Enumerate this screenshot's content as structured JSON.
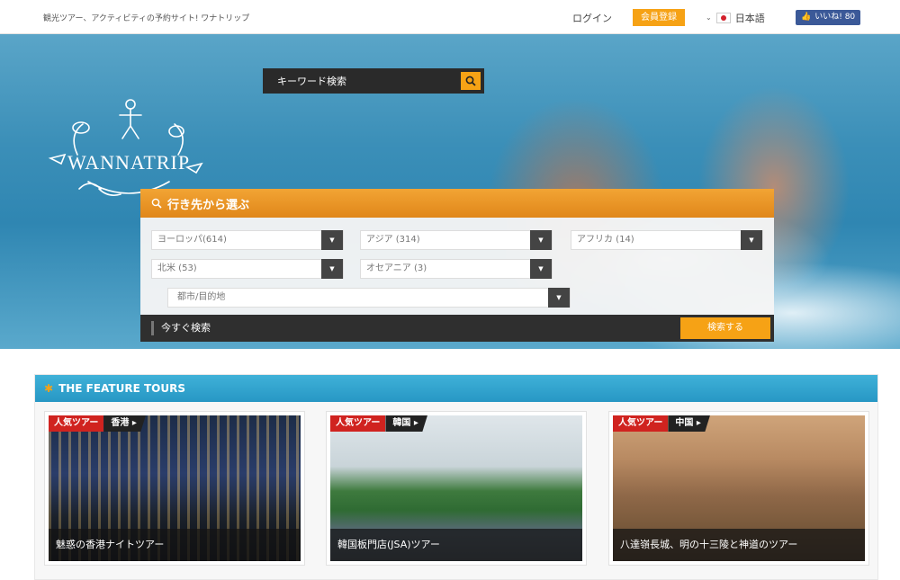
{
  "topbar": {
    "tagline": "観光ツアー、アクティビティの予約サイト! ワナトリップ",
    "login": "ログイン",
    "register": "会員登録",
    "language": "日本語",
    "like": "いいね! 80"
  },
  "hero": {
    "logo_text": "WANNATRIP",
    "keyword_placeholder": "キーワード検索"
  },
  "destination": {
    "title": "行き先から選ぶ",
    "selects": [
      "ヨーロッパ(614)",
      "アジア (314)",
      "アフリカ (14)",
      "北米 (53)",
      "オセアニア (3)",
      "都市/目的地"
    ],
    "footer_label": "今すぐ検索",
    "search_button": "検索する"
  },
  "feature": {
    "title": "THE FEATURE TOURS",
    "cards": [
      {
        "badge": "人気ツアー",
        "region": "香港",
        "title": "魅惑の香港ナイトツアー"
      },
      {
        "badge": "人気ツアー",
        "region": "韓国",
        "title": "韓国板門店(JSA)ツアー"
      },
      {
        "badge": "人気ツアー",
        "region": "中国",
        "title": "八達嶺長城、明の十三陵と神道のツアー"
      }
    ]
  },
  "colors": {
    "accent_orange": "#f6a215",
    "header_blue": "#2f9fca",
    "badge_red": "#d0231f"
  },
  "icons": [
    "search-icon",
    "chevron-down-icon",
    "flag-japan-icon",
    "thumbs-up-icon",
    "gear-icon"
  ]
}
